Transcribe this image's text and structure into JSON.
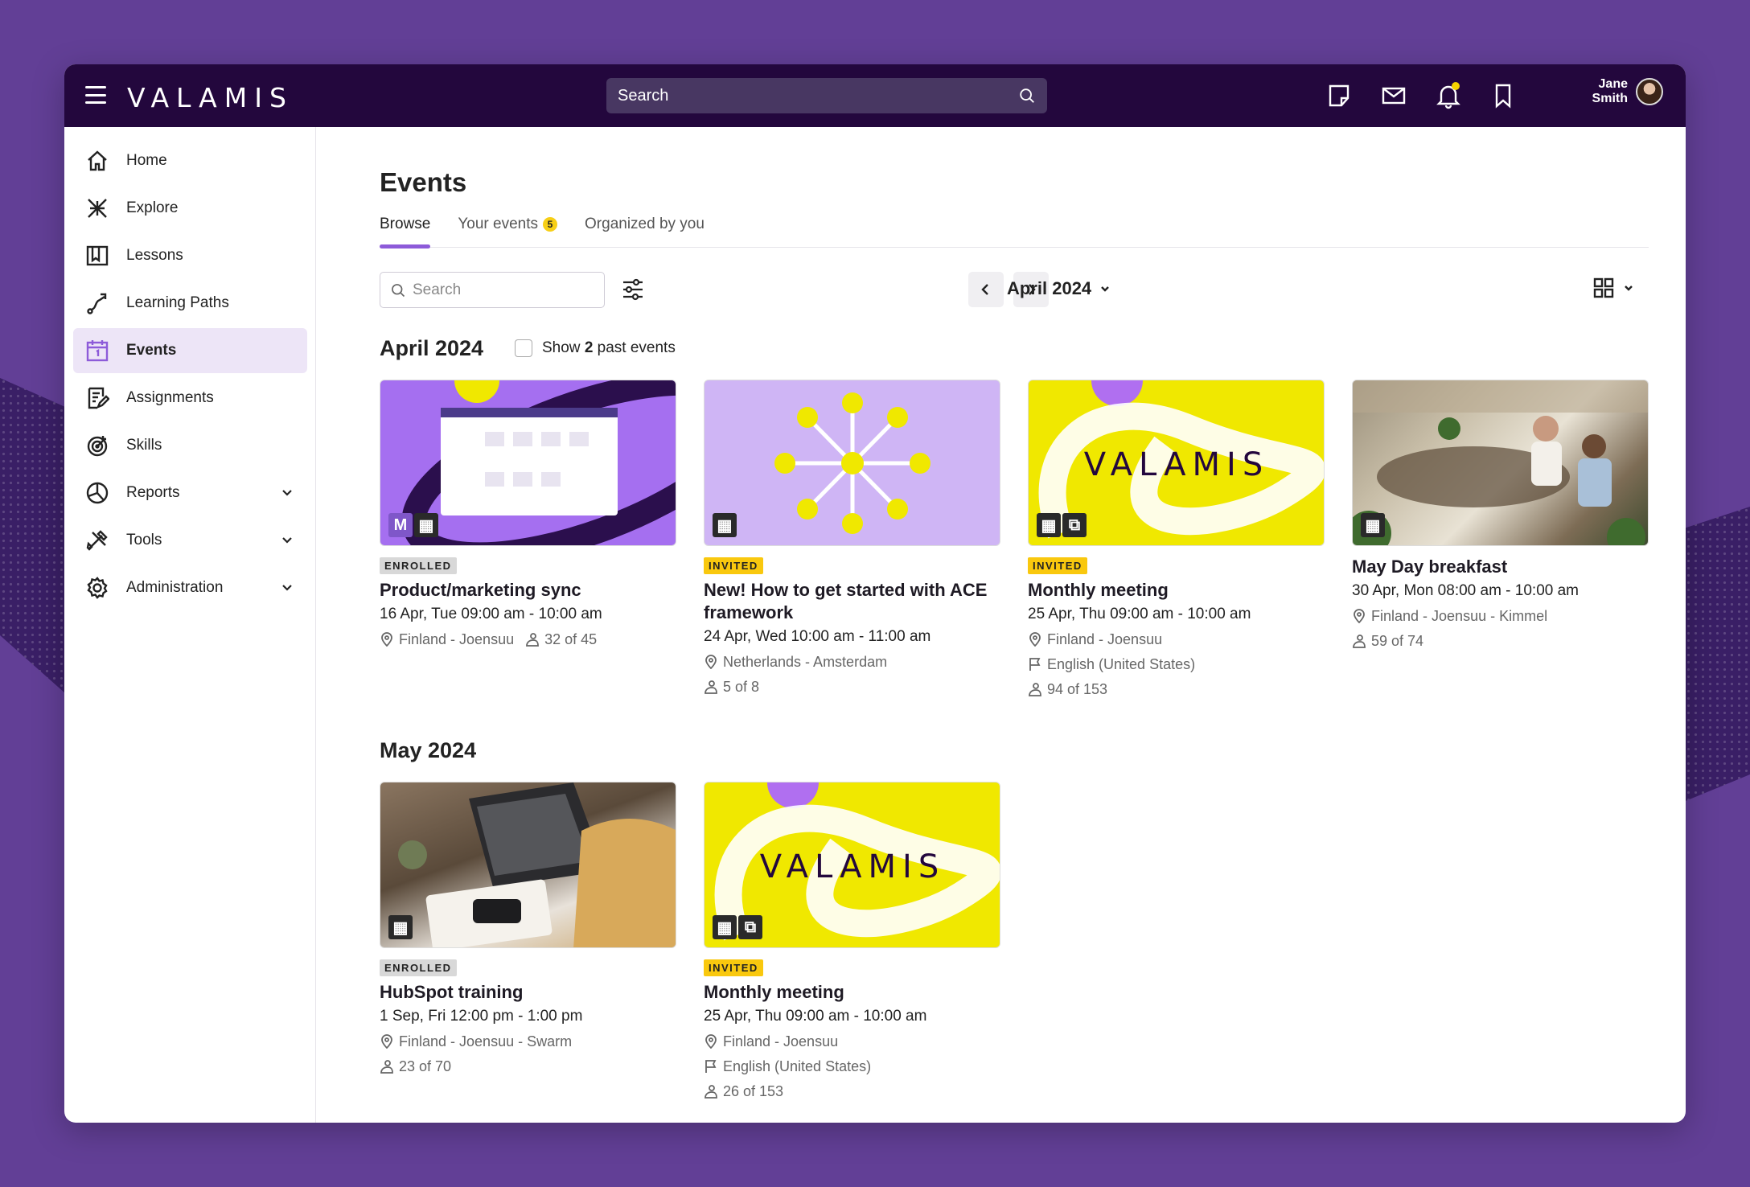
{
  "brand": {
    "logo_text": "VALAMIS",
    "accent": "#8d5bd9",
    "topbar_color": "#23073d",
    "background": "#623f96"
  },
  "topbar": {
    "search_placeholder": "Search",
    "icons": [
      "notes-icon",
      "mail-icon",
      "bell-icon",
      "bookmark-icon"
    ],
    "user": {
      "first": "Jane",
      "last": "Smith"
    }
  },
  "sidebar": {
    "items": [
      {
        "label": "Home",
        "icon": "home-icon"
      },
      {
        "label": "Explore",
        "icon": "explore-icon"
      },
      {
        "label": "Lessons",
        "icon": "book-icon"
      },
      {
        "label": "Learning Paths",
        "icon": "path-icon"
      },
      {
        "label": "Events",
        "icon": "calendar-icon",
        "active": true
      },
      {
        "label": "Assignments",
        "icon": "assignment-icon"
      },
      {
        "label": "Skills",
        "icon": "target-icon"
      },
      {
        "label": "Reports",
        "icon": "pie-chart-icon",
        "expandable": true
      },
      {
        "label": "Tools",
        "icon": "tools-icon",
        "expandable": true
      },
      {
        "label": "Administration",
        "icon": "gear-icon",
        "expandable": true
      }
    ]
  },
  "page": {
    "title": "Events",
    "tabs": [
      {
        "label": "Browse",
        "active": true
      },
      {
        "label": "Your events",
        "badge": "5"
      },
      {
        "label": "Organized by you"
      }
    ],
    "search_placeholder": "Search",
    "current_month": "April 2024",
    "past_prefix": "Show ",
    "past_count": "2",
    "past_suffix": " past events"
  },
  "sections": [
    {
      "heading": "April 2024",
      "cards": [
        {
          "status": "ENROLLED",
          "title": "Product/marketing sync",
          "date": "16 Apr, Tue 09:00 am - 10:00 am",
          "location": "Finland - Joensuu",
          "seats": "32 of 45",
          "thumb": "purple-ui"
        },
        {
          "status": "INVITED",
          "title": "New! How to get started with ACE framework",
          "date": "24 Apr, Wed 10:00 am - 11:00 am",
          "location": "Netherlands - Amsterdam",
          "seats": "5 of 8",
          "thumb": "lilac-star"
        },
        {
          "status": "INVITED",
          "title": "Monthly meeting",
          "date": "25 Apr, Thu 09:00 am - 10:00 am",
          "location": "Finland - Joensuu",
          "language": "English (United States)",
          "seats": "94 of 153",
          "thumb": "yellow-logo"
        },
        {
          "title": "May Day breakfast",
          "date": "30 Apr, Mon 08:00 am - 10:00 am",
          "location": "Finland - Joensuu - Kimmel",
          "seats": "59 of 74",
          "thumb": "photo-cafe"
        }
      ]
    },
    {
      "heading": "May 2024",
      "cards": [
        {
          "status": "ENROLLED",
          "title": "HubSpot training",
          "date": "1 Sep, Fri 12:00 pm - 1:00 pm",
          "location": "Finland - Joensuu - Swarm",
          "seats": "23 of 70",
          "thumb": "photo-laptop"
        },
        {
          "status": "INVITED",
          "title": "Monthly meeting",
          "date": "25 Apr, Thu 09:00 am - 10:00 am",
          "location": "Finland - Joensuu",
          "language": "English (United States)",
          "seats": "26 of 153",
          "thumb": "yellow-logo"
        }
      ]
    }
  ]
}
